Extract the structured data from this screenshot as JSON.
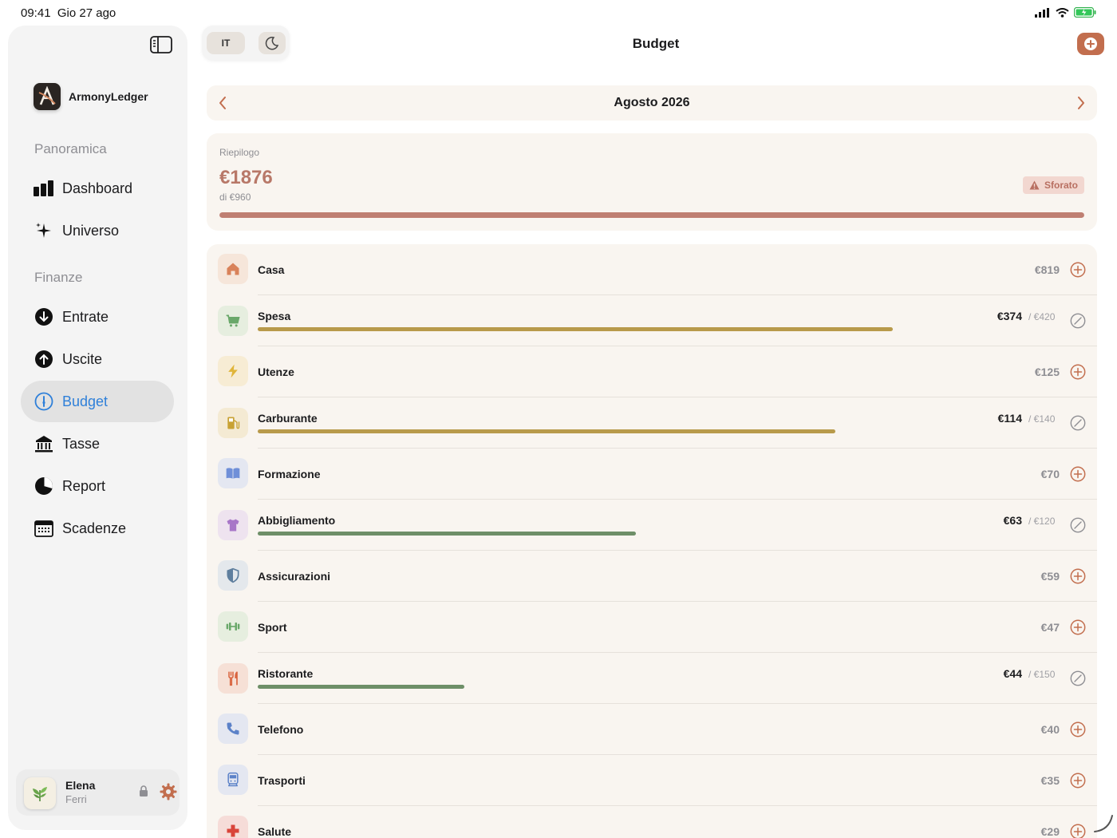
{
  "status_bar": {
    "time": "09:41",
    "date": "Gio 27 ago"
  },
  "sidebar": {
    "brand": {
      "name": "ArmonyLedger"
    },
    "sections": [
      {
        "label": "Panoramica",
        "items": [
          {
            "label": "Dashboard",
            "icon": "chart-bars-icon"
          },
          {
            "label": "Universo",
            "icon": "sparkles-icon"
          }
        ]
      },
      {
        "label": "Finanze",
        "items": [
          {
            "label": "Entrate",
            "icon": "arrow-down-circle-icon"
          },
          {
            "label": "Uscite",
            "icon": "arrow-up-circle-icon"
          },
          {
            "label": "Budget",
            "icon": "gauge-icon",
            "active": true
          },
          {
            "label": "Tasse",
            "icon": "bank-icon"
          },
          {
            "label": "Report",
            "icon": "pie-chart-icon"
          },
          {
            "label": "Scadenze",
            "icon": "calendar-icon"
          }
        ]
      }
    ],
    "user": {
      "first_name": "Elena",
      "last_name": "Ferri"
    }
  },
  "toolbar": {
    "language": "IT",
    "title": "Budget"
  },
  "month": {
    "label": "Agosto 2026"
  },
  "summary": {
    "title": "Riepilogo",
    "amount": "€1876",
    "of_label": "di €960",
    "badge": "Sforato",
    "progress": 1.0
  },
  "colors": {
    "accent": "#c26e4e",
    "active_nav": "#2f80d9",
    "over_budget": "#bf7f72"
  },
  "categories": [
    {
      "name": "Casa",
      "amount": "€819",
      "icon": "house-icon",
      "icon_color": "#d9825a",
      "icon_bg": "#f6e6da"
    },
    {
      "name": "Spesa",
      "amount": "€374",
      "limit": "/ €420",
      "progress": 0.89,
      "bar_color": "#b89a4b",
      "icon": "cart-icon",
      "icon_color": "#6aa86a",
      "icon_bg": "#e6eedf"
    },
    {
      "name": "Utenze",
      "amount": "€125",
      "icon": "bolt-icon",
      "icon_color": "#e0b53a",
      "icon_bg": "#f7ecd4"
    },
    {
      "name": "Carburante",
      "amount": "€114",
      "limit": "/ €140",
      "progress": 0.81,
      "bar_color": "#b89a4b",
      "icon": "fuel-icon",
      "icon_color": "#c8a234",
      "icon_bg": "#f4ead3"
    },
    {
      "name": "Formazione",
      "amount": "€70",
      "icon": "book-icon",
      "icon_color": "#6f8fd8",
      "icon_bg": "#e4e7f1"
    },
    {
      "name": "Abbigliamento",
      "amount": "€63",
      "limit": "/ €120",
      "progress": 0.53,
      "bar_color": "#6e8f68",
      "icon": "shirt-icon",
      "icon_color": "#a877c8",
      "icon_bg": "#eee3ef"
    },
    {
      "name": "Assicurazioni",
      "amount": "€59",
      "icon": "shield-icon",
      "icon_color": "#5f7f9e",
      "icon_bg": "#e4e8ec"
    },
    {
      "name": "Sport",
      "amount": "€47",
      "icon": "dumbbell-icon",
      "icon_color": "#6aa86a",
      "icon_bg": "#e6eedf"
    },
    {
      "name": "Ristorante",
      "amount": "€44",
      "limit": "/ €150",
      "progress": 0.29,
      "bar_color": "#6e8f68",
      "icon": "fork-knife-icon",
      "icon_color": "#d9643f",
      "icon_bg": "#f6e0d6"
    },
    {
      "name": "Telefono",
      "amount": "€40",
      "icon": "phone-icon",
      "icon_color": "#5c82c8",
      "icon_bg": "#e4e7f1"
    },
    {
      "name": "Trasporti",
      "amount": "€35",
      "icon": "bus-icon",
      "icon_color": "#5c82c8",
      "icon_bg": "#e4e7f1"
    },
    {
      "name": "Salute",
      "amount": "€29",
      "icon": "cross-icon",
      "icon_color": "#d9443a",
      "icon_bg": "#f6dcd8"
    }
  ]
}
